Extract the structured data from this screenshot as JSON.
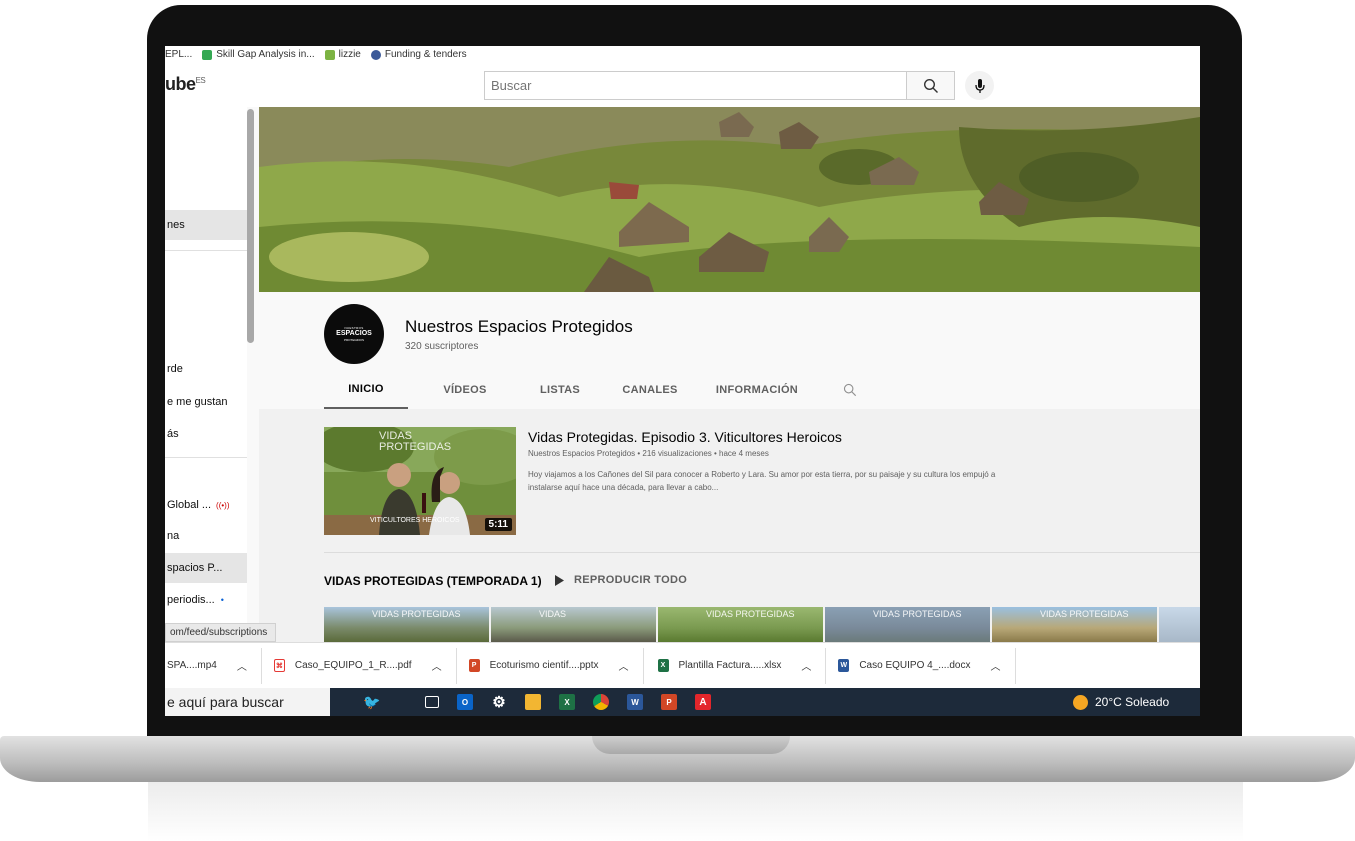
{
  "bookmarks": [
    {
      "label": "EPL...",
      "color": "#888888"
    },
    {
      "label": "Skill Gap Analysis in...",
      "color": "#34a853"
    },
    {
      "label": "lizzie",
      "color": "#7cb342"
    },
    {
      "label": "Funding & tenders",
      "color": "#3b5998"
    }
  ],
  "masthead": {
    "logo": "ube",
    "logo_region": "ES",
    "search_placeholder": "Buscar",
    "search_icon": "search-icon",
    "mic_icon": "microphone-icon"
  },
  "sidebar": {
    "items": [
      {
        "label": "nes",
        "active": true
      },
      {
        "label": "rde",
        "active": false
      },
      {
        "label": "e me gustan",
        "active": false
      },
      {
        "label": "ás",
        "active": false
      },
      {
        "label": "Global ...",
        "active": false,
        "badge": "live"
      },
      {
        "label": "na",
        "active": false
      },
      {
        "label": "spacios P...",
        "active": true
      },
      {
        "label": "periodis...",
        "active": false,
        "badge": "new"
      }
    ]
  },
  "status_url": "om/feed/subscriptions",
  "channel": {
    "avatar_small_top": "NUESTROS",
    "avatar_main": "ESPACIOS",
    "avatar_small_bottom": "PROTEGIDOS",
    "name": "Nuestros Espacios Protegidos",
    "subscribers": "320 suscriptores",
    "tabs": [
      {
        "label": "INICIO",
        "active": true
      },
      {
        "label": "VÍDEOS",
        "active": false
      },
      {
        "label": "LISTAS",
        "active": false
      },
      {
        "label": "CANALES",
        "active": false
      },
      {
        "label": "INFORMACIÓN",
        "active": false
      }
    ]
  },
  "featured": {
    "thumb_title_1": "VIDAS",
    "thumb_title_2": "PROTEGIDAS",
    "thumb_caption": "VITICULTORES HEROICOS",
    "duration": "5:11",
    "title": "Vidas Protegidas. Episodio 3. Viticultores Heroicos",
    "meta": "Nuestros Espacios Protegidos • 216 visualizaciones • hace 4 meses",
    "description": "Hoy viajamos a los Cañones del Sil para conocer a Roberto y Lara. Su amor por esta tierra, por su paisaje y su cultura los empujó a instalarse aquí hace una década, para llevar a cabo..."
  },
  "shelf": {
    "title": "VIDAS PROTEGIDAS (TEMPORADA 1)",
    "play_all": "REPRODUCIR TODO",
    "thumbs": [
      {
        "label": "VIDAS PROTEGIDAS"
      },
      {
        "label": "VIDAS"
      },
      {
        "label": "VIDAS PROTEGIDAS"
      },
      {
        "label": "VIDAS PROTEGIDAS"
      },
      {
        "label": "VIDAS PROTEGIDAS"
      }
    ]
  },
  "downloads": [
    {
      "name": "SPA....mp4",
      "type": "video",
      "color": "#607d8b"
    },
    {
      "name": "Caso_EQUIPO_1_R....pdf",
      "type": "pdf",
      "color": "#e53935"
    },
    {
      "name": "Ecoturismo cientif....pptx",
      "type": "pptx",
      "color": "#d24726"
    },
    {
      "name": "Plantilla Factura.....xlsx",
      "type": "xlsx",
      "color": "#1e7145"
    },
    {
      "name": "Caso EQUIPO 4_....docx",
      "type": "docx",
      "color": "#2b579a"
    }
  ],
  "taskbar": {
    "search_text": "e aquí para buscar",
    "weather": "20°C Soleado"
  }
}
